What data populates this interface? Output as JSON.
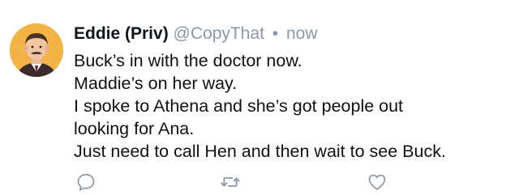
{
  "tweet": {
    "display_name": "Eddie (Priv)",
    "handle": "@CopyThat",
    "separator": "•",
    "time": "now",
    "lines": [
      "Buck’s in with the doctor now.",
      "Maddie’s on her way.",
      "I spoke to Athena and she’s got people out",
      "looking for Ana.",
      "Just need to call Hen and then wait to see Buck."
    ]
  },
  "actions": {
    "reply_icon": "speech-bubble-icon",
    "retweet_icon": "retweet-arrows-icon",
    "like_icon": "heart-outline-icon"
  },
  "colors": {
    "text": "#0f1419",
    "muted": "#8b98a5",
    "icon": "#8b98a5",
    "avatar_bg": "#f2b445"
  }
}
